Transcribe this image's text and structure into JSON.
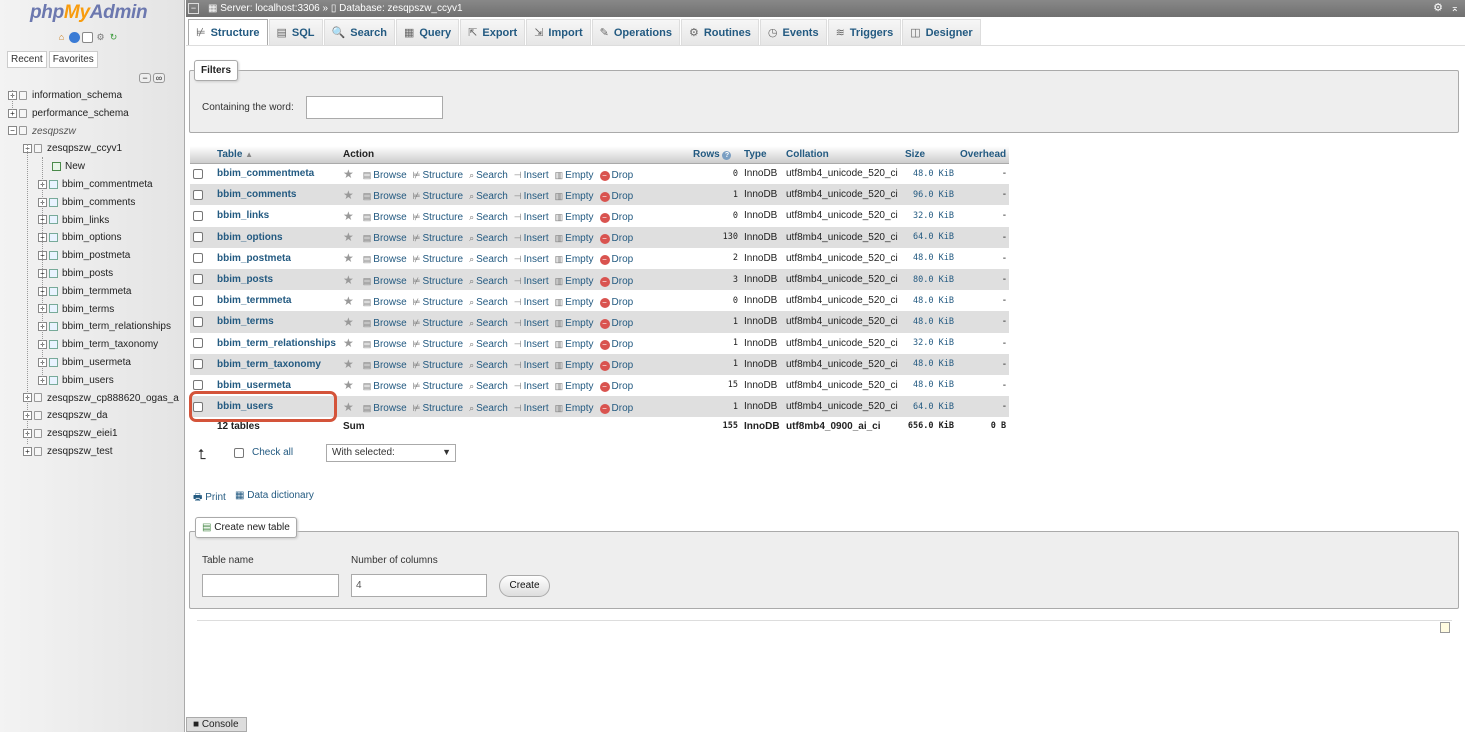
{
  "logo": {
    "php": "php",
    "my": "My",
    "admin": "Admin"
  },
  "nav": {
    "recent_tab": "Recent",
    "favorites_tab": "Favorites",
    "tree": [
      {
        "label": "information_schema",
        "level": 0
      },
      {
        "label": "performance_schema",
        "level": 0
      },
      {
        "label": "zesqpszw",
        "level": 0
      },
      {
        "label": "zesqpszw_ccyv1",
        "level": 1
      },
      {
        "label": "New",
        "level": 2
      },
      {
        "label": "bbim_commentmeta",
        "level": 2
      },
      {
        "label": "bbim_comments",
        "level": 2
      },
      {
        "label": "bbim_links",
        "level": 2
      },
      {
        "label": "bbim_options",
        "level": 2
      },
      {
        "label": "bbim_postmeta",
        "level": 2
      },
      {
        "label": "bbim_posts",
        "level": 2
      },
      {
        "label": "bbim_termmeta",
        "level": 2
      },
      {
        "label": "bbim_terms",
        "level": 2
      },
      {
        "label": "bbim_term_relationships",
        "level": 2
      },
      {
        "label": "bbim_term_taxonomy",
        "level": 2
      },
      {
        "label": "bbim_usermeta",
        "level": 2
      },
      {
        "label": "bbim_users",
        "level": 2
      },
      {
        "label": "zesqpszw_cp888620_ogas_a",
        "level": 1
      },
      {
        "label": "zesqpszw_da",
        "level": 1
      },
      {
        "label": "zesqpszw_eiei1",
        "level": 1
      },
      {
        "label": "zesqpszw_test",
        "level": 1
      }
    ]
  },
  "topbar": {
    "server": "Server: localhost:3306",
    "separator": "»",
    "database": "Database: zesqpszw_ccyv1"
  },
  "tabs": [
    {
      "label": "Structure",
      "icon": "structure-icon",
      "glyph": "⊭"
    },
    {
      "label": "SQL",
      "icon": "sql-icon",
      "glyph": "▤"
    },
    {
      "label": "Search",
      "icon": "search-icon",
      "glyph": "🔍"
    },
    {
      "label": "Query",
      "icon": "query-icon",
      "glyph": "▦"
    },
    {
      "label": "Export",
      "icon": "export-icon",
      "glyph": "⇱"
    },
    {
      "label": "Import",
      "icon": "import-icon",
      "glyph": "⇲"
    },
    {
      "label": "Operations",
      "icon": "wrench-icon",
      "glyph": "✎"
    },
    {
      "label": "Routines",
      "icon": "routines-icon",
      "glyph": "⚙"
    },
    {
      "label": "Events",
      "icon": "clock-icon",
      "glyph": "◷"
    },
    {
      "label": "Triggers",
      "icon": "triggers-icon",
      "glyph": "≋"
    },
    {
      "label": "Designer",
      "icon": "designer-icon",
      "glyph": "◫"
    }
  ],
  "filters": {
    "legend": "Filters",
    "label": "Containing the word:",
    "value": ""
  },
  "table": {
    "headers": {
      "table": "Table",
      "action": "Action",
      "rows": "Rows",
      "type": "Type",
      "collation": "Collation",
      "size": "Size",
      "overhead": "Overhead"
    },
    "actions": {
      "browse": "Browse",
      "structure": "Structure",
      "search": "Search",
      "insert": "Insert",
      "empty": "Empty",
      "drop": "Drop"
    },
    "rows": [
      {
        "name": "bbim_commentmeta",
        "rows": "0",
        "type": "InnoDB",
        "collation": "utf8mb4_unicode_520_ci",
        "size": "48.0",
        "unit": "KiB",
        "overhead": "-"
      },
      {
        "name": "bbim_comments",
        "rows": "1",
        "type": "InnoDB",
        "collation": "utf8mb4_unicode_520_ci",
        "size": "96.0",
        "unit": "KiB",
        "overhead": "-"
      },
      {
        "name": "bbim_links",
        "rows": "0",
        "type": "InnoDB",
        "collation": "utf8mb4_unicode_520_ci",
        "size": "32.0",
        "unit": "KiB",
        "overhead": "-"
      },
      {
        "name": "bbim_options",
        "rows": "130",
        "type": "InnoDB",
        "collation": "utf8mb4_unicode_520_ci",
        "size": "64.0",
        "unit": "KiB",
        "overhead": "-"
      },
      {
        "name": "bbim_postmeta",
        "rows": "2",
        "type": "InnoDB",
        "collation": "utf8mb4_unicode_520_ci",
        "size": "48.0",
        "unit": "KiB",
        "overhead": "-"
      },
      {
        "name": "bbim_posts",
        "rows": "3",
        "type": "InnoDB",
        "collation": "utf8mb4_unicode_520_ci",
        "size": "80.0",
        "unit": "KiB",
        "overhead": "-"
      },
      {
        "name": "bbim_termmeta",
        "rows": "0",
        "type": "InnoDB",
        "collation": "utf8mb4_unicode_520_ci",
        "size": "48.0",
        "unit": "KiB",
        "overhead": "-"
      },
      {
        "name": "bbim_terms",
        "rows": "1",
        "type": "InnoDB",
        "collation": "utf8mb4_unicode_520_ci",
        "size": "48.0",
        "unit": "KiB",
        "overhead": "-"
      },
      {
        "name": "bbim_term_relationships",
        "rows": "1",
        "type": "InnoDB",
        "collation": "utf8mb4_unicode_520_ci",
        "size": "32.0",
        "unit": "KiB",
        "overhead": "-"
      },
      {
        "name": "bbim_term_taxonomy",
        "rows": "1",
        "type": "InnoDB",
        "collation": "utf8mb4_unicode_520_ci",
        "size": "48.0",
        "unit": "KiB",
        "overhead": "-"
      },
      {
        "name": "bbim_usermeta",
        "rows": "15",
        "type": "InnoDB",
        "collation": "utf8mb4_unicode_520_ci",
        "size": "48.0",
        "unit": "KiB",
        "overhead": "-"
      },
      {
        "name": "bbim_users",
        "rows": "1",
        "type": "InnoDB",
        "collation": "utf8mb4_unicode_520_ci",
        "size": "64.0",
        "unit": "KiB",
        "overhead": "-"
      }
    ],
    "summary": {
      "count": "12 tables",
      "label": "Sum",
      "rows": "155",
      "type": "InnoDB",
      "collation": "utf8mb4_0900_ai_ci",
      "size": "656.0",
      "unit": "KiB",
      "overhead": "0 B"
    }
  },
  "check_all": {
    "label": "Check all",
    "with_selected": "With selected:"
  },
  "links": {
    "print": "Print",
    "data_dictionary": "Data dictionary"
  },
  "create_table": {
    "legend": "Create new table",
    "table_name_label": "Table name",
    "table_name_value": "",
    "columns_label": "Number of columns",
    "columns_value": "4",
    "button": "Create"
  },
  "console": {
    "label": "Console"
  },
  "colors": {
    "link": "#235a81",
    "highlight": "#d4543a",
    "logo_blue": "#6c78af",
    "logo_orange": "#f89c0e"
  }
}
